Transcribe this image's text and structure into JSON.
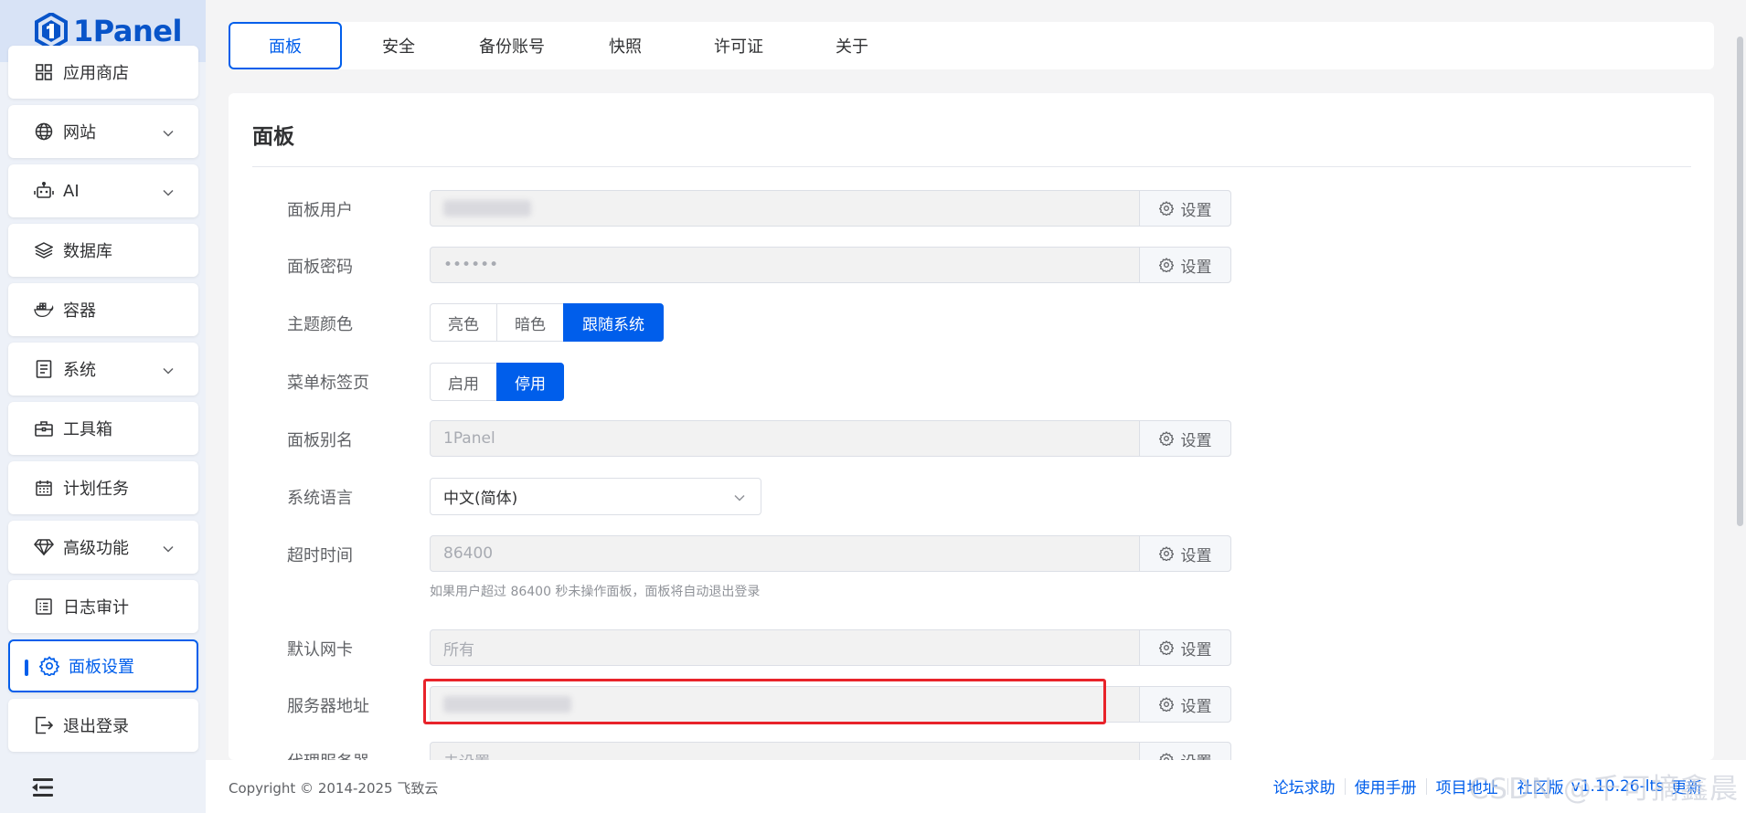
{
  "app": {
    "logo_text": "1Panel"
  },
  "sidebar": {
    "items": [
      {
        "label": "应用商店",
        "icon": "app-store-icon",
        "expandable": false
      },
      {
        "label": "网站",
        "icon": "globe-icon",
        "expandable": true
      },
      {
        "label": "AI",
        "icon": "robot-icon",
        "expandable": true
      },
      {
        "label": "数据库",
        "icon": "layers-icon",
        "expandable": false
      },
      {
        "label": "容器",
        "icon": "docker-icon",
        "expandable": false
      },
      {
        "label": "系统",
        "icon": "system-icon",
        "expandable": true
      },
      {
        "label": "工具箱",
        "icon": "toolbox-icon",
        "expandable": false
      },
      {
        "label": "计划任务",
        "icon": "calendar-icon",
        "expandable": false
      },
      {
        "label": "高级功能",
        "icon": "diamond-icon",
        "expandable": true
      },
      {
        "label": "日志审计",
        "icon": "log-icon",
        "expandable": false
      },
      {
        "label": "面板设置",
        "icon": "gear-icon",
        "expandable": false,
        "active": true
      },
      {
        "label": "退出登录",
        "icon": "logout-icon",
        "expandable": false
      }
    ]
  },
  "tabs": [
    {
      "label": "面板",
      "active": true
    },
    {
      "label": "安全"
    },
    {
      "label": "备份账号"
    },
    {
      "label": "快照"
    },
    {
      "label": "许可证"
    },
    {
      "label": "关于"
    }
  ],
  "panel": {
    "title": "面板",
    "set_label": "设置",
    "fields": {
      "user": {
        "label": "面板用户",
        "value": ""
      },
      "password": {
        "label": "面板密码",
        "value": "••••••"
      },
      "theme": {
        "label": "主题颜色",
        "options": [
          "亮色",
          "暗色",
          "跟随系统"
        ],
        "selected": "跟随系统"
      },
      "menu_tabs": {
        "label": "菜单标签页",
        "options": [
          "启用",
          "停用"
        ],
        "selected": "停用"
      },
      "alias": {
        "label": "面板别名",
        "value": "1Panel"
      },
      "language": {
        "label": "系统语言",
        "value": "中文(简体)"
      },
      "timeout": {
        "label": "超时时间",
        "value": "86400",
        "hint": "如果用户超过 86400 秒未操作面板，面板将自动退出登录"
      },
      "nic": {
        "label": "默认网卡",
        "value": "所有"
      },
      "server_addr": {
        "label": "服务器地址",
        "value": ""
      },
      "proxy": {
        "label": "代理服务器",
        "value": "未设置"
      }
    }
  },
  "footer": {
    "copyright": "Copyright © 2014-2025 飞致云",
    "links": [
      "论坛求助",
      "使用手册",
      "项目地址",
      "社区版",
      "v1.10.26-lts",
      "更新"
    ],
    "watermark": "CSDN @千可摘鑫晨"
  },
  "colors": {
    "accent": "#005eeb",
    "highlight_box": "#e8232a"
  }
}
